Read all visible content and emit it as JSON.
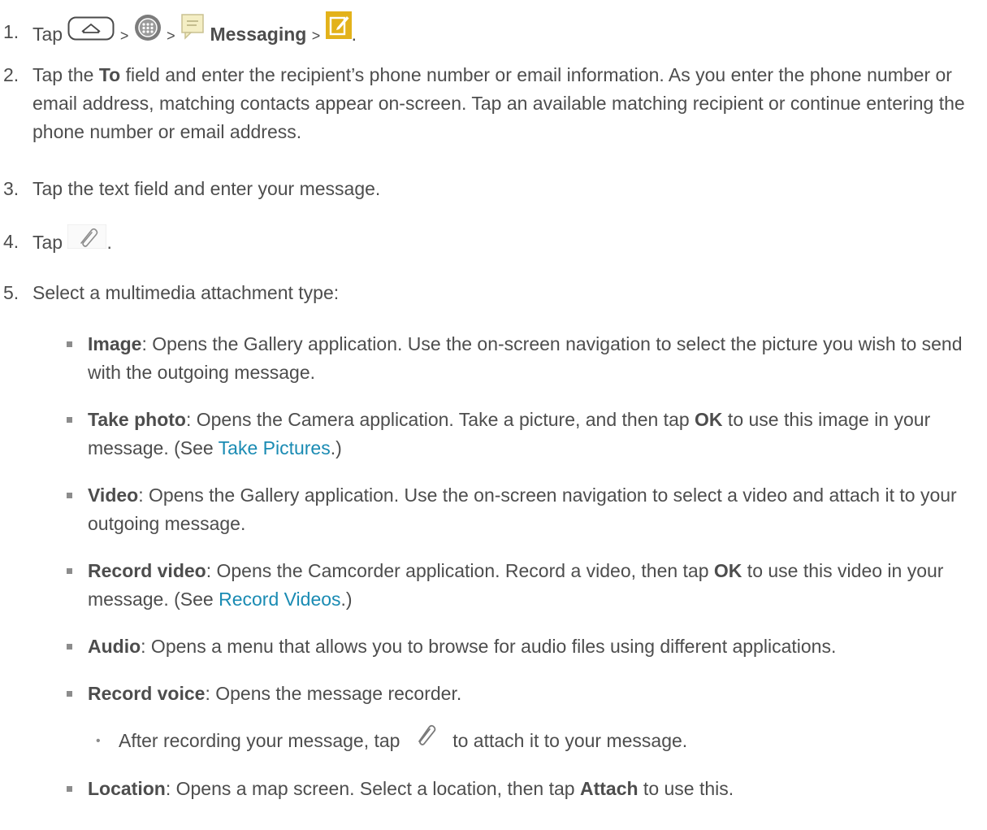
{
  "steps": {
    "s1": {
      "num": "1.",
      "tap": "Tap",
      "sep1": ">",
      "sep2": ">",
      "messaging": "Messaging",
      "sep3": ">",
      "end": "."
    },
    "s2": {
      "num": "2.",
      "pre": "Tap the ",
      "to": "To",
      "post": " field and enter the recipient’s phone number or email information. As you enter the phone number or email address, matching contacts appear on-screen. Tap an available matching recipient or continue entering the phone number or email address."
    },
    "s3": {
      "num": "3.",
      "text": "Tap the text field and enter your message."
    },
    "s4": {
      "num": "4.",
      "tap": "Tap",
      "end": "."
    },
    "s5": {
      "num": "5.",
      "text": "Select a multimedia attachment type:"
    }
  },
  "options": {
    "image": {
      "label": "Image",
      "text": ": Opens the Gallery application. Use the on-screen navigation to select the picture you wish to send with the outgoing message."
    },
    "take_photo": {
      "label": "Take photo",
      "text1": ": Opens the Camera application. Take a picture, and then tap ",
      "ok": "OK",
      "text2": " to use this image in your message. (See ",
      "link": "Take Pictures",
      "text3": ".)"
    },
    "video": {
      "label": "Video",
      "text": ": Opens the Gallery application. Use the on-screen navigation to select a video and attach it to your outgoing message."
    },
    "record_video": {
      "label": "Record video",
      "text1": ": Opens the Camcorder application. Record a video, then tap ",
      "ok": "OK",
      "text2": " to use this video in your message. (See ",
      "link": "Record Videos",
      "text3": ".)"
    },
    "audio": {
      "label": "Audio",
      "text": ": Opens a menu that allows you to browse for audio files using different applications."
    },
    "record_voice": {
      "label": "Record voice",
      "text": ": Opens the message recorder."
    },
    "record_voice_sub": {
      "pre": "After recording your message, tap",
      "post": "to attach it to your message."
    },
    "location": {
      "label": "Location",
      "text1": ": Opens a map screen. Select a location, then tap ",
      "attach": "Attach",
      "text2": " to use this."
    }
  },
  "colors": {
    "text": "#4d4d4d",
    "link": "#1a8bb3",
    "compose_icon": "#e3b21a"
  },
  "icons": [
    "home-key-icon",
    "apps-icon",
    "messaging-app-icon",
    "compose-icon",
    "paperclip-icon"
  ]
}
